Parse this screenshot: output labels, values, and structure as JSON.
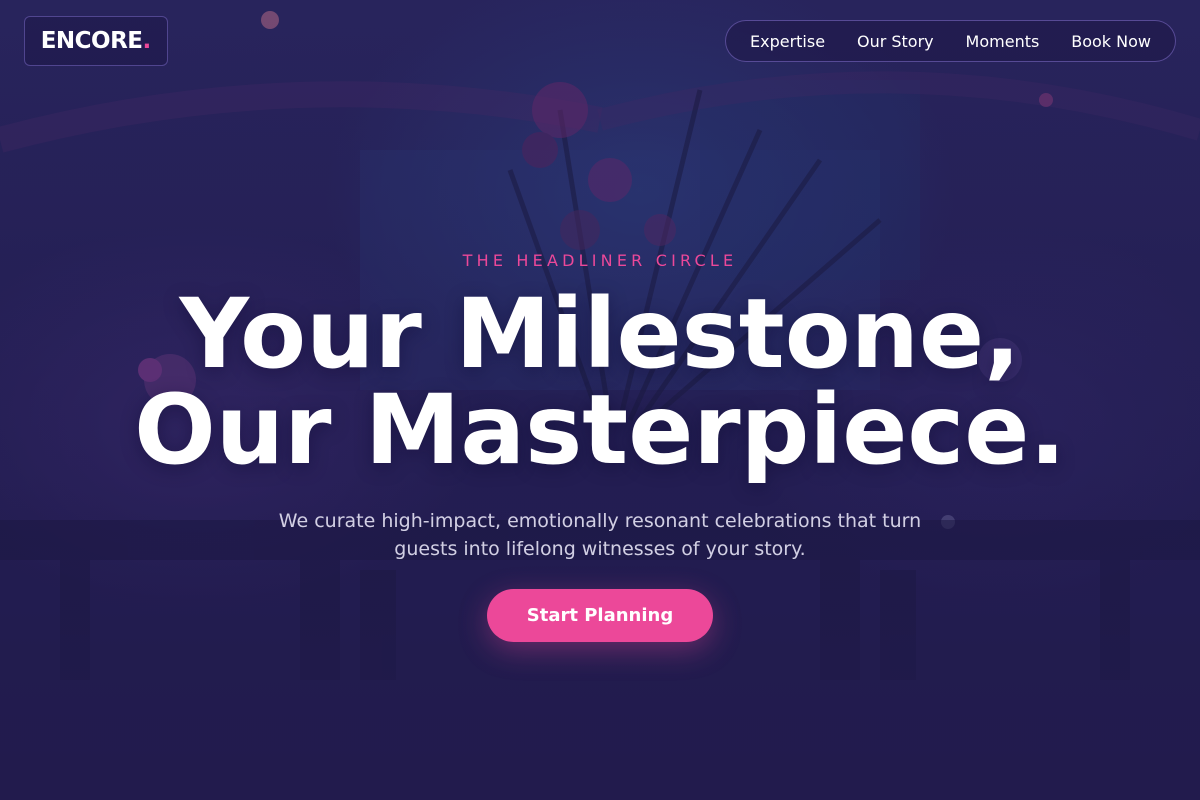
{
  "brand": {
    "logo_text": "ENCORE",
    "logo_dot": ".",
    "accent_color": "#ec4899",
    "background_color": "#221c4f"
  },
  "nav": {
    "items": [
      {
        "label": "Expertise"
      },
      {
        "label": "Our Story"
      },
      {
        "label": "Moments"
      },
      {
        "label": "Book Now"
      }
    ]
  },
  "hero": {
    "eyebrow": "THE HEADLINER CIRCLE",
    "headline_line1": "Your Milestone,",
    "headline_line2": "Our Masterpiece.",
    "subtitle": "We curate high-impact, emotionally resonant celebrations that turn guests into lifelong witnesses of your story.",
    "cta_label": "Start Planning",
    "background_image": "event-venue-photo"
  }
}
